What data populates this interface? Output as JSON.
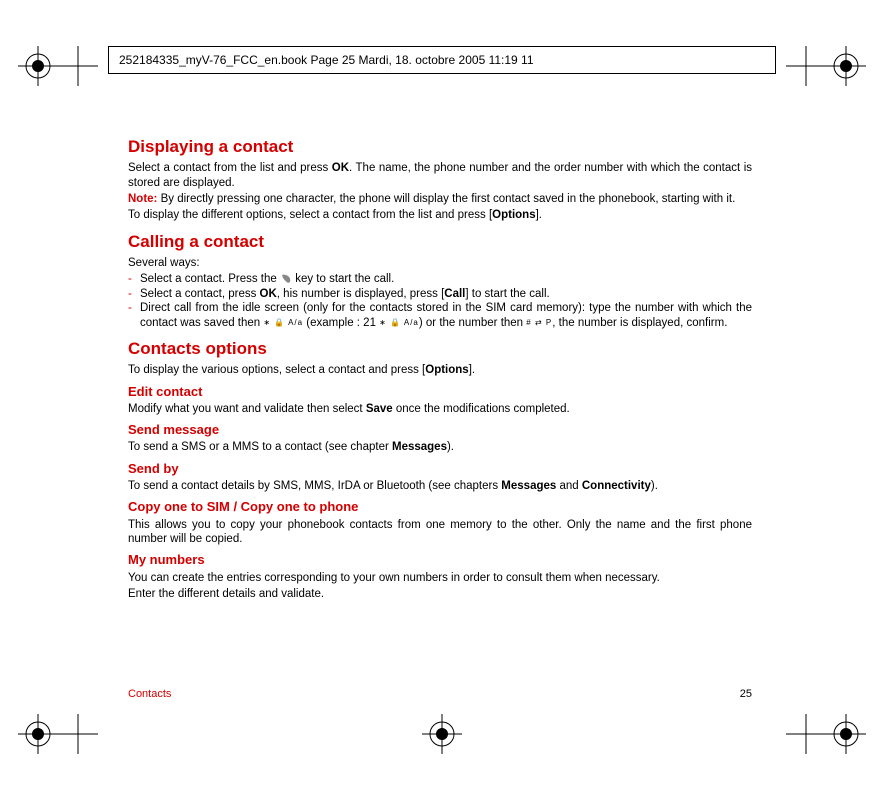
{
  "header": "252184335_myV-76_FCC_en.book  Page 25  Mardi, 18. octobre 2005  11:19 11",
  "sections": {
    "displaying": {
      "title": "Displaying a contact",
      "p1a": "Select a contact from the list and press ",
      "p1b": "OK",
      "p1c": ". The name, the phone number and the order number with which the contact is stored are displayed.",
      "noteLabel": "Note: ",
      "noteText": "By directly pressing one character, the phone will display the first contact saved in the phonebook, starting with it.",
      "p2a": "To display the different options, select a contact from the list and press [",
      "p2b": "Options",
      "p2c": "]."
    },
    "calling": {
      "title": "Calling a contact",
      "intro": "Several ways:",
      "item1a": "Select a contact. Press the ",
      "item1b": " key to start the call.",
      "item2a": "Select a contact, press ",
      "item2b": "OK",
      "item2c": ", his number is displayed, press [",
      "item2d": "Call",
      "item2e": "] to start the call.",
      "item3a": "Direct call from the idle screen (only for the contacts stored in the SIM card memory): type the number with which the contact was saved then ",
      "item3b": " (example : 21 ",
      "item3c": ") or the number then ",
      "item3d": ", the number is displayed, confirm."
    },
    "options": {
      "title": "Contacts options",
      "introA": "To display the various options, select a contact and press [",
      "introB": "Options",
      "introC": "].",
      "edit": {
        "title": "Edit contact",
        "p1a": "Modify what you want and validate then select ",
        "p1b": "Save",
        "p1c": " once the modifications completed."
      },
      "sendmsg": {
        "title": "Send message",
        "p1a": "To send a SMS or a MMS to a contact (see chapter ",
        "p1b": "Messages",
        "p1c": ")."
      },
      "sendby": {
        "title": "Send by",
        "p1a": "To send a contact details by SMS, MMS, IrDA or Bluetooth (see chapters ",
        "p1b": "Messages",
        "p1c": " and ",
        "p1d": "Connectivity",
        "p1e": ")."
      },
      "copy": {
        "title": "Copy one to SIM / Copy one to phone",
        "p1": "This allows you to copy your phonebook contacts from one memory to the other. Only the name and the first phone number will be copied."
      },
      "mynum": {
        "title": "My numbers",
        "p1": "You can create the entries corresponding to your own numbers in order to consult them when necessary.",
        "p2": "Enter the different details and validate."
      }
    }
  },
  "footer": {
    "section": "Contacts",
    "page": "25"
  },
  "symbols": {
    "star": "∗",
    "lock": "🔒",
    "aa": "A/a",
    "hash": "#",
    "arrows": "⇄",
    "p": "P"
  }
}
